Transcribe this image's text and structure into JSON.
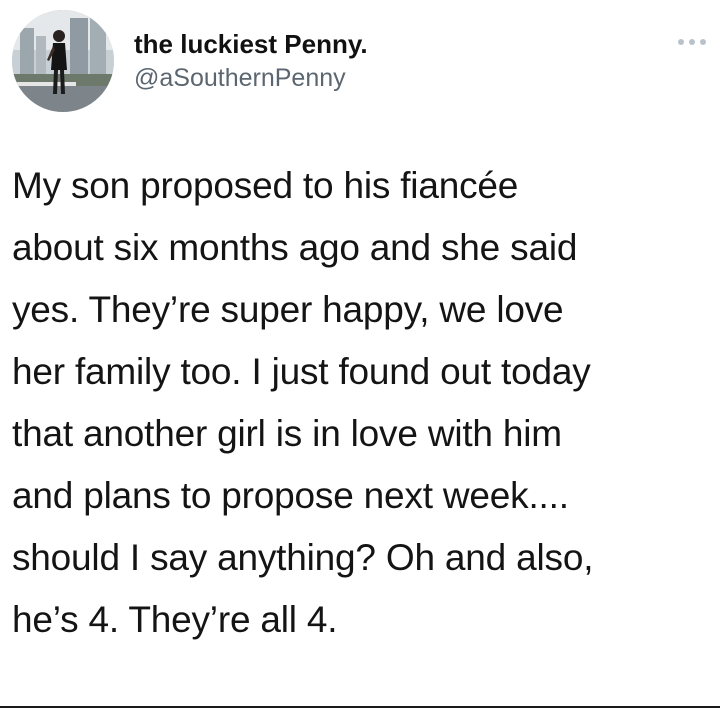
{
  "tweet": {
    "author": {
      "display_name": "the luckiest Penny.",
      "handle": "@aSouthernPenny",
      "avatar_icon": "profile-photo"
    },
    "more_icon": "ellipsis-icon",
    "text_lines": [
      "My son proposed to his fiancée",
      "about six months ago and she said",
      "yes. They’re super happy, we love",
      "her family too.  I just found out today",
      "that another girl is in love with him",
      "and plans to propose next week....",
      "should I say anything? Oh and also,",
      "he’s 4. They’re all 4."
    ]
  }
}
